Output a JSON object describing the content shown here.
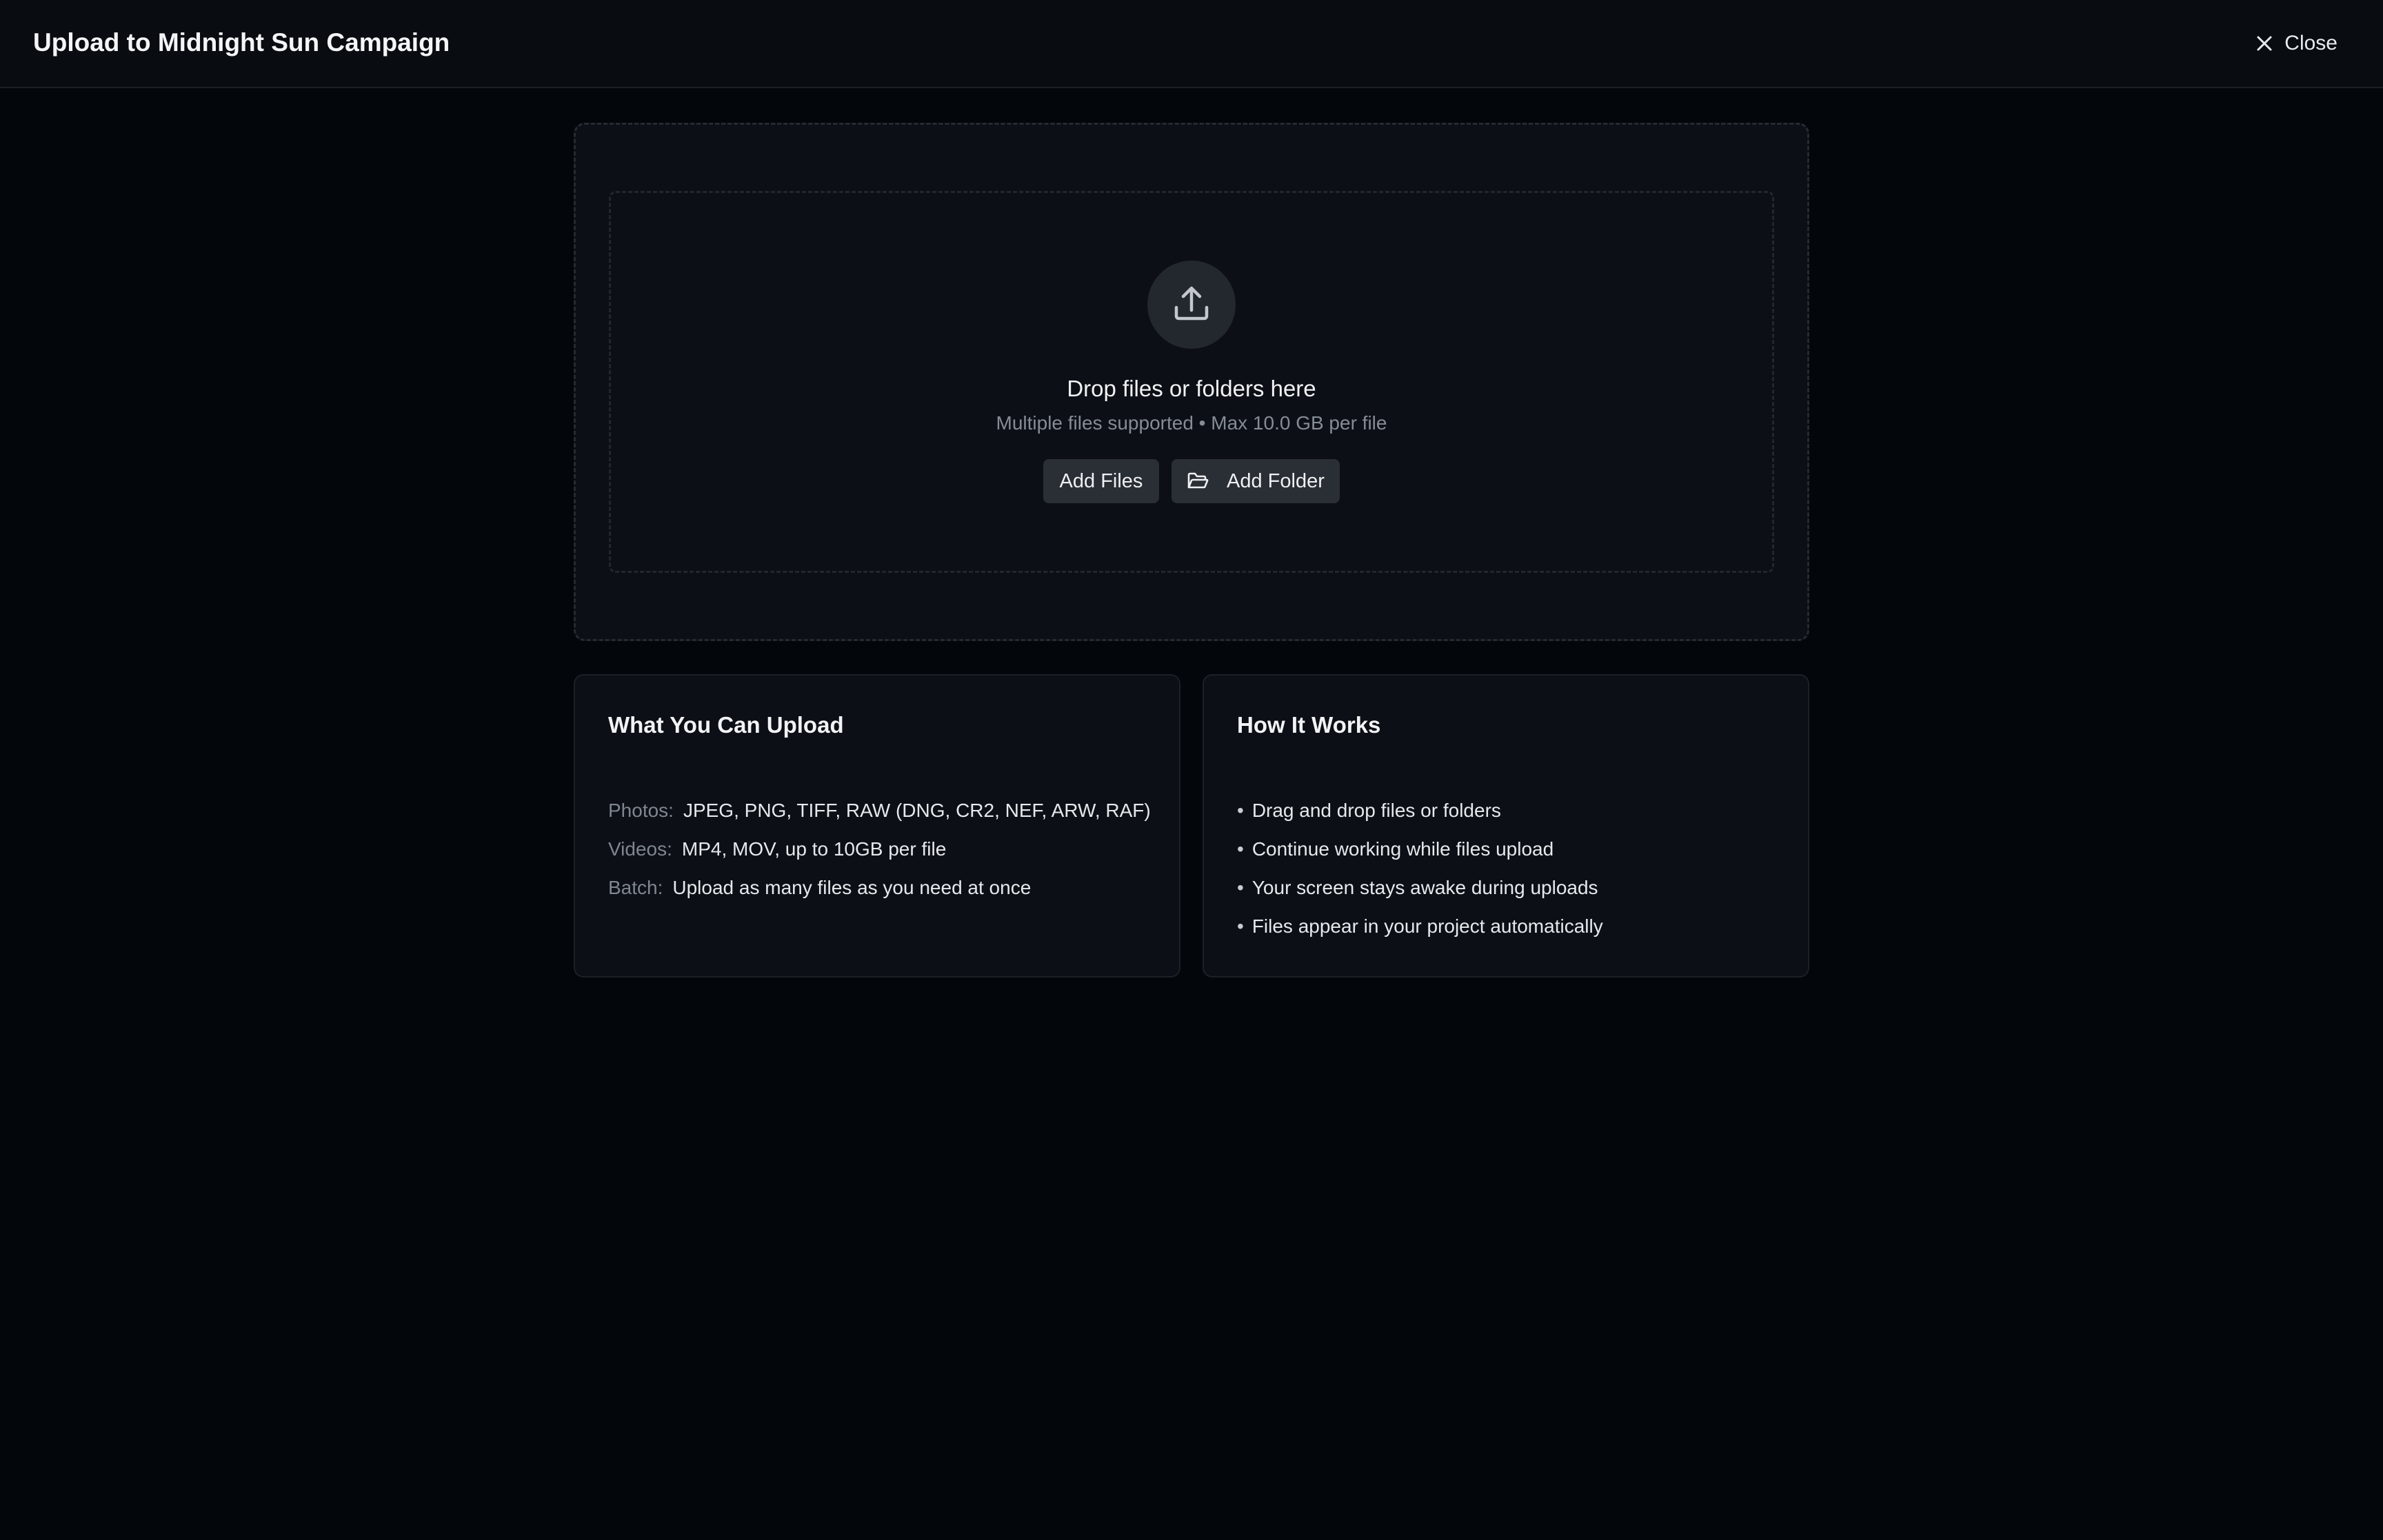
{
  "header": {
    "title": "Upload to Midnight Sun Campaign",
    "close_label": "Close",
    "close_icon": "close-icon"
  },
  "dropzone": {
    "icon": "upload-icon",
    "title": "Drop files or folders here",
    "subtitle": "Multiple files supported • Max 10.0 GB per file",
    "add_files_label": "Add Files",
    "add_folder_label": "Add Folder",
    "add_folder_icon": "folder-open-icon"
  },
  "upload_types": {
    "title": "What You Can Upload",
    "items": [
      {
        "label": "Photos:",
        "value": "JPEG, PNG, TIFF, RAW (DNG, CR2, NEF, ARW, RAF)"
      },
      {
        "label": "Videos:",
        "value": "MP4, MOV, up to 10GB per file"
      },
      {
        "label": "Batch:",
        "value": "Upload as many files as you need at once"
      }
    ]
  },
  "how_it_works": {
    "title": "How It Works",
    "bullet": "•",
    "items": [
      "Drag and drop files or folders",
      "Continue working while files upload",
      "Your screen stays awake during uploads",
      "Files appear in your project automatically"
    ]
  },
  "colors": {
    "background": "#03060a",
    "header_bg": "#090c11",
    "card_bg": "#0c1016",
    "button_bg": "#2a2e35",
    "muted_text": "#868c95"
  }
}
